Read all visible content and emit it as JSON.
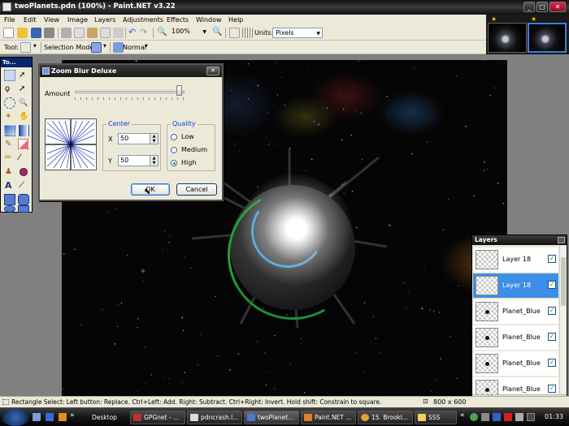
{
  "window": {
    "title": "twoPlanets.pdn (100%) - Paint.NET v3.22",
    "min": "_",
    "max": "□",
    "close": "✕"
  },
  "menu": [
    "File",
    "Edit",
    "View",
    "Image",
    "Layers",
    "Adjustments",
    "Effects",
    "Window",
    "Help"
  ],
  "toolbar": {
    "zoom_value": "100%",
    "units_label": "Units:",
    "units_value": "Pixels"
  },
  "toolbar2": {
    "tool_label": "Tool:",
    "selection_mode_label": "Selection Mode:",
    "blend_mode": "Normal"
  },
  "tools_panel": {
    "title": "To..."
  },
  "dialog": {
    "title": "Zoom Blur Deluxe",
    "amount_label": "Amount",
    "amount_fraction": 0.95,
    "center_label": "Center",
    "x_label": "X",
    "x_value": "50",
    "y_label": "Y",
    "y_value": "50",
    "quality_label": "Quality",
    "quality_options": [
      "Low",
      "Medium",
      "High"
    ],
    "quality_selected": "High",
    "ok": "OK",
    "cancel": "Cancel"
  },
  "layers": {
    "title": "Layers",
    "items": [
      {
        "name": "Layer 18",
        "selected": false,
        "thumb": "empty"
      },
      {
        "name": "Layer 18",
        "selected": true,
        "thumb": "empty"
      },
      {
        "name": "Planet_Blue",
        "selected": false,
        "thumb": "planet"
      },
      {
        "name": "Planet_Blue",
        "selected": false,
        "thumb": "planet"
      },
      {
        "name": "Planet_Blue",
        "selected": false,
        "thumb": "planet"
      },
      {
        "name": "Planet_Blue",
        "selected": false,
        "thumb": "planet"
      }
    ]
  },
  "status": {
    "text": "Rectangle Select: Left button: Replace. Ctrl+Left: Add. Right: Subtract. Ctrl+Right: Invert. Hold shift: Constrain to square.",
    "size": "800 x 600"
  },
  "taskbar": {
    "quick": "»",
    "desktop": "Desktop",
    "tasks": [
      "GPGnet - ...",
      "pdncrash.l...",
      "twoPlanet...",
      "Paint.NET ...",
      "15. Brookl...",
      "SSS"
    ],
    "clock": "01:33",
    "tray_more": "«"
  }
}
